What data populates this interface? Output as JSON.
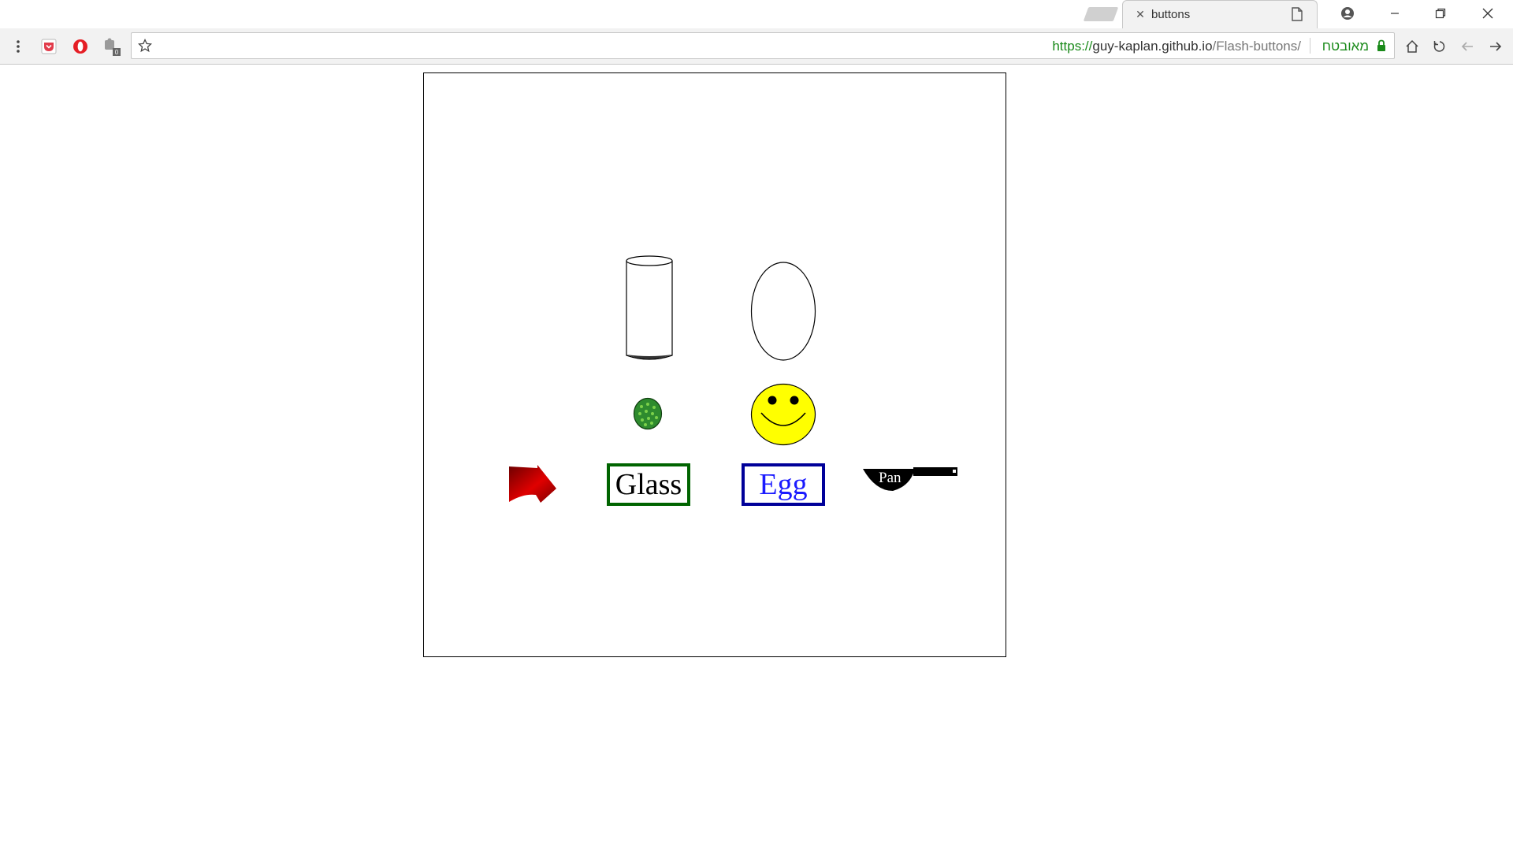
{
  "browser": {
    "tab": {
      "title": "buttons"
    },
    "address_bar": {
      "url_scheme": "https://",
      "url_host": "guy-kaplan.github.io",
      "url_path": "/Flash-buttons/",
      "security_label": "מאובטח"
    },
    "colors": {
      "secure_green": "#1a8a1a",
      "toolbar_bg": "#f2f2f2"
    }
  },
  "page": {
    "buttons": {
      "glass_label": "Glass",
      "egg_label": "Egg",
      "pan_label": "Pan"
    },
    "colors": {
      "glass_border": "#006400",
      "egg_border": "#000099",
      "egg_text": "#1a1aff",
      "smiley_fill": "#ffff00",
      "pea_fill": "#2e8b2e",
      "arrow_fill": "#cc0000"
    }
  }
}
